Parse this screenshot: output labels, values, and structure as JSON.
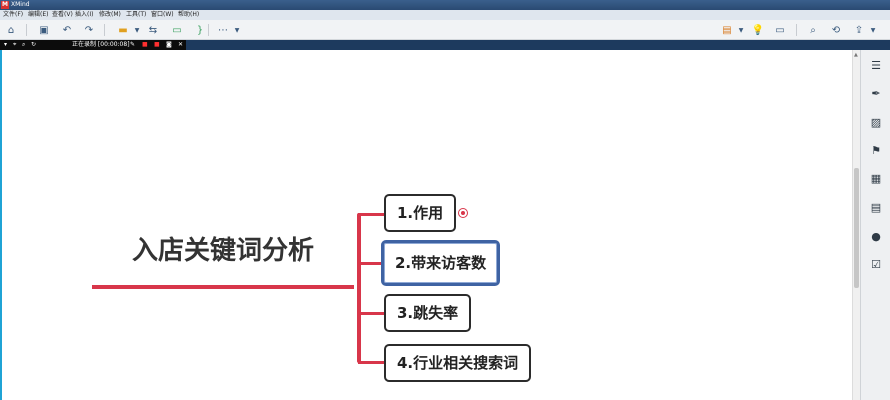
{
  "titlebar": {
    "logo": "M",
    "title": "XMind"
  },
  "menubar": {
    "items": [
      "文件(F)",
      "编辑(E)",
      "查看(V)",
      "插入(I)",
      "修改(M)",
      "工具(T)",
      "窗口(W)",
      "帮助(H)"
    ]
  },
  "toolbar": {
    "icons": [
      "home-icon",
      "save-icon",
      "undo-icon",
      "redo-icon",
      "topic-icon",
      "relationship-icon",
      "boundary-icon",
      "summary-icon",
      "more-icon",
      "presentation-icon",
      "idea-icon",
      "layout-icon",
      "search-icon",
      "share-icon",
      "export-icon"
    ]
  },
  "recording": {
    "status": "正在录制 [00:00:08]"
  },
  "mindmap": {
    "central": "入店关键词分析",
    "subtopics": [
      {
        "label": "1.作用"
      },
      {
        "label": "2.带来访客数"
      },
      {
        "label": "3.跳失率"
      },
      {
        "label": "4.行业相关搜索词"
      }
    ]
  },
  "sidepanel": {
    "icons": [
      "outline-icon",
      "format-brush-icon",
      "image-icon",
      "flag-icon",
      "label-icon",
      "notes-icon",
      "comment-icon",
      "task-icon"
    ]
  },
  "colors": {
    "branch": "#d8364a",
    "selection": "#3f63a3",
    "accent": "#1fa3d5"
  }
}
